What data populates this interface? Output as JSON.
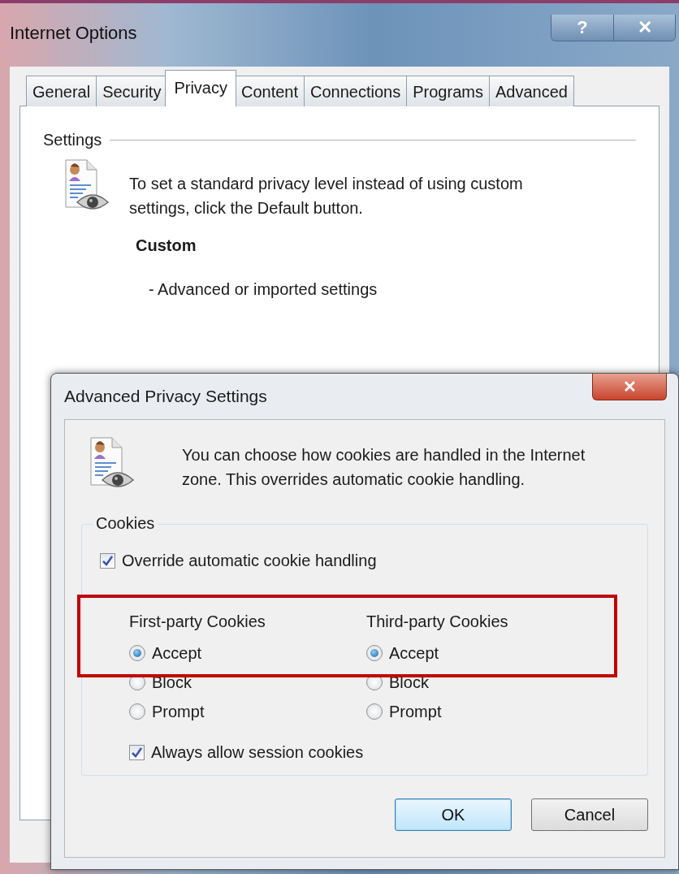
{
  "window": {
    "title": "Internet Options",
    "help_button": "?",
    "close_button": "✕"
  },
  "tabs": [
    {
      "label": "General",
      "selected": false
    },
    {
      "label": "Security",
      "selected": false
    },
    {
      "label": "Privacy",
      "selected": true
    },
    {
      "label": "Content",
      "selected": false
    },
    {
      "label": "Connections",
      "selected": false
    },
    {
      "label": "Programs",
      "selected": false
    },
    {
      "label": "Advanced",
      "selected": false
    }
  ],
  "settings": {
    "heading": "Settings",
    "description": "To set a standard privacy level instead of using custom settings, click the Default button.",
    "level_name": "Custom",
    "level_detail": "- Advanced or imported settings"
  },
  "dialog": {
    "title": "Advanced Privacy Settings",
    "close_button": "✕",
    "description": "You can choose how cookies are handled in the Internet zone.  This overrides automatic cookie handling.",
    "cookies": {
      "heading": "Cookies",
      "override": {
        "label": "Override automatic cookie handling",
        "checked": true
      },
      "highlighted": true,
      "columns": [
        {
          "heading": "First-party Cookies",
          "options": [
            {
              "label": "Accept",
              "selected": true
            },
            {
              "label": "Block",
              "selected": false
            },
            {
              "label": "Prompt",
              "selected": false
            }
          ]
        },
        {
          "heading": "Third-party Cookies",
          "options": [
            {
              "label": "Accept",
              "selected": true
            },
            {
              "label": "Block",
              "selected": false
            },
            {
              "label": "Prompt",
              "selected": false
            }
          ]
        }
      ],
      "session": {
        "label": "Always allow session cookies",
        "checked": true
      }
    },
    "buttons": [
      {
        "label": "OK",
        "default": true
      },
      {
        "label": "Cancel",
        "default": false
      }
    ]
  }
}
